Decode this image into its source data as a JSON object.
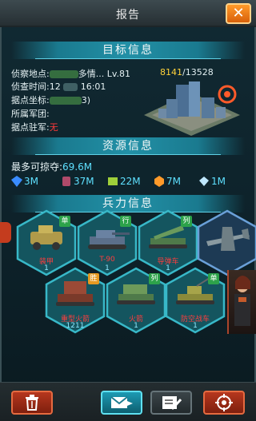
{
  "header": {
    "title": "报告",
    "close": "✕"
  },
  "sections": {
    "target": "目标信息",
    "resources": "资源信息",
    "troops": "兵力信息"
  },
  "target": {
    "scout_label": "侦察地点:",
    "scout_value": "多情...",
    "level": "Lv.81",
    "time_label": "侦查时间:",
    "time_date": "12",
    "time_clock": "16:01",
    "coords_label": "据点坐标:",
    "coords_suffix": "3)",
    "legion_label": "所属军团:",
    "garrison_label": "据点驻军:",
    "garrison_value": "无",
    "power_current": "8141",
    "power_max": "/13528"
  },
  "resources": {
    "loot_label": "最多可掠夺:",
    "loot_value": "69.6M",
    "items": [
      {
        "icon": "crystal-icon",
        "value": "3M",
        "color": "#3a8cff"
      },
      {
        "icon": "oil-barrel-icon",
        "value": "37M",
        "color": "#b04a6a"
      },
      {
        "icon": "steel-icon",
        "value": "22M",
        "color": "#9fcf3a"
      },
      {
        "icon": "ore-icon",
        "value": "7M",
        "color": "#ff9a2a"
      },
      {
        "icon": "gem-icon",
        "value": "1M",
        "color": "#bfe8ff"
      }
    ]
  },
  "troops": [
    {
      "name": "装甲",
      "count": "1",
      "tag": "单",
      "tag_color": "green",
      "icon": "armored-car-icon"
    },
    {
      "name": "T-90",
      "count": "1",
      "tag": "行",
      "tag_color": "green",
      "icon": "tank-icon"
    },
    {
      "name": "导弹车",
      "count": "1",
      "tag": "列",
      "tag_color": "green",
      "icon": "missile-launcher-icon"
    },
    {
      "name": "",
      "count": "",
      "tag": "",
      "tag_color": "",
      "icon": "fighter-plane-icon"
    },
    {
      "name": "重型火箭",
      "count": "1211",
      "tag": "胜",
      "tag_color": "orange",
      "icon": "rocket-artillery-icon"
    },
    {
      "name": "火箭",
      "count": "1",
      "tag": "列",
      "tag_color": "green",
      "icon": "rocket-truck-icon"
    },
    {
      "name": "防空战车",
      "count": "1",
      "tag": "单",
      "tag_color": "green",
      "icon": "aa-vehicle-icon"
    }
  ],
  "bottom": {
    "delete_icon": "trash-icon",
    "mail_icon": "mail-send-icon",
    "edit_icon": "edit-note-icon",
    "target_icon": "crosshair-icon"
  }
}
